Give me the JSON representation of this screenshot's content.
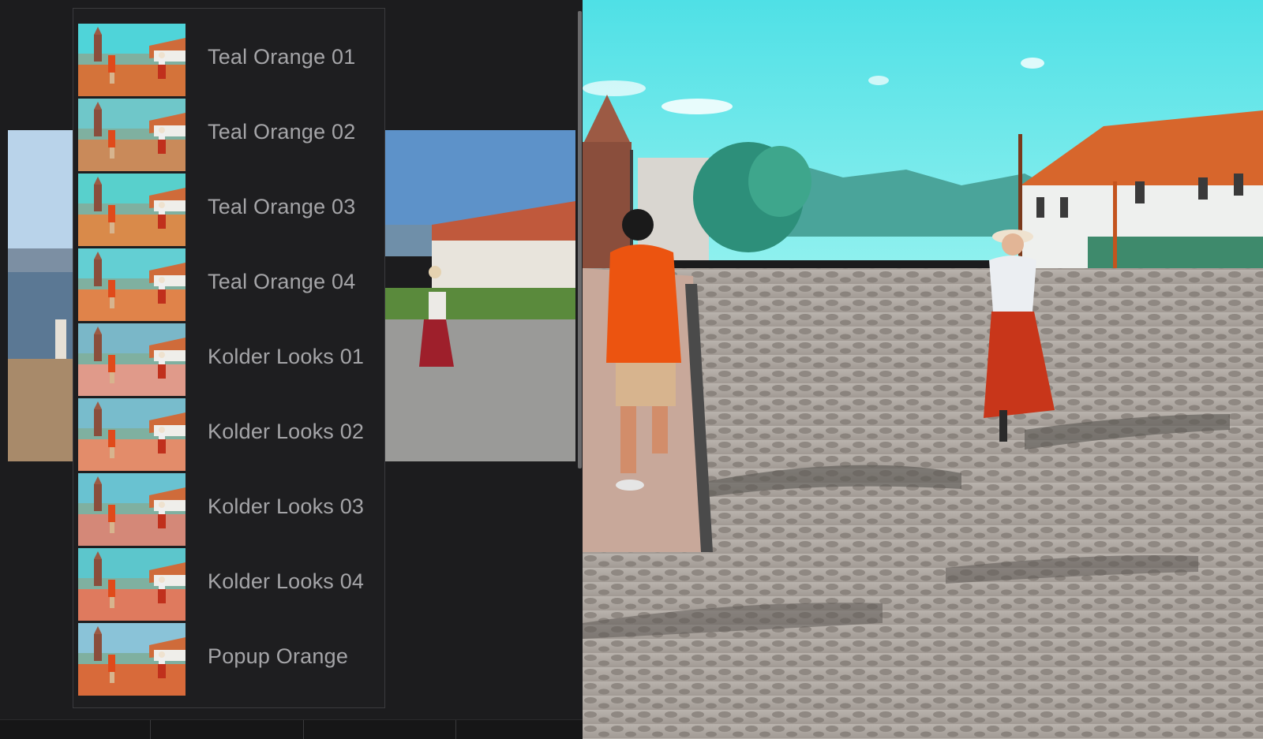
{
  "preset_panel": {
    "items": [
      {
        "label": "Teal Orange 01"
      },
      {
        "label": "Teal Orange 02"
      },
      {
        "label": "Teal Orange 03"
      },
      {
        "label": "Teal Orange 04"
      },
      {
        "label": "Kolder Looks 01"
      },
      {
        "label": "Kolder Looks 02"
      },
      {
        "label": "Kolder Looks 03"
      },
      {
        "label": "Kolder Looks 04"
      },
      {
        "label": "Popup Orange"
      }
    ]
  },
  "colors": {
    "panel_bg": "#1c1c1e",
    "label": "#a5a5a8",
    "sky_teal": "#5fe3e6",
    "orange": "#e8590c"
  }
}
